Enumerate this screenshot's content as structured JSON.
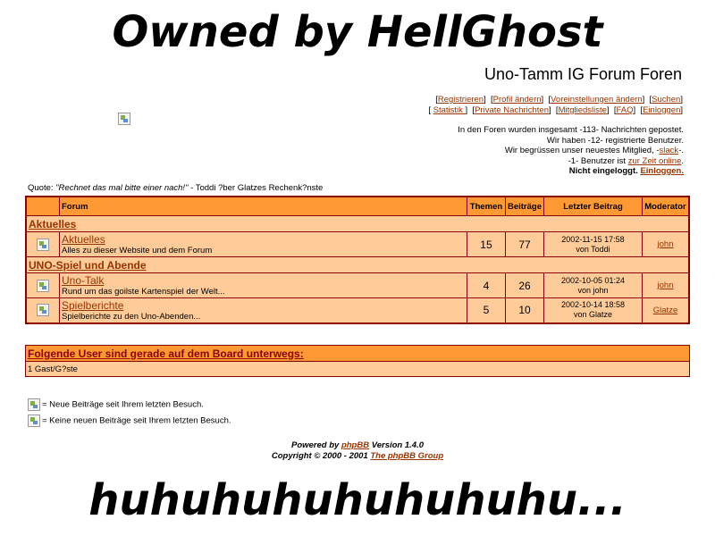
{
  "banner": {
    "top": "Owned by HellGhost",
    "bottom": "huhuhuhuhuhuhuhu..."
  },
  "site_title": "Uno-Tamm IG Forum Foren",
  "nav": {
    "row1": [
      "Registrieren",
      "Profil ändern",
      "Voreinstellungen ändern",
      "Suchen"
    ],
    "row2": [
      "Statistik ",
      "Private Nachrichten",
      "Mitgliedsliste",
      "FAQ",
      "Einloggen"
    ]
  },
  "stats": {
    "line1": "In den Foren wurden insgesamt -113- Nachrichten gepostet.",
    "line2": "Wir haben -12- registrierte Benutzer.",
    "line3_pre": "Wir begrüssen unser neuestes Mitglied, -",
    "line3_link": "slack",
    "line3_post": "-.",
    "line4_pre": "-1- Benutzer ist ",
    "line4_link": "zur Zeit online",
    "line4_post": ".",
    "line5_pre": "Nicht eingeloggt. ",
    "line5_link": "Einloggen."
  },
  "quote": {
    "label": "Quote: ",
    "text": "\"Rechnet das mal bitte einer nach!\"",
    "source": " - Toddi ?ber Glatzes Rechenk?nste"
  },
  "table": {
    "headers": {
      "forum": "Forum",
      "topics": "Themen",
      "posts": "Beiträge",
      "last": "Letzter Beitrag",
      "mod": "Moderator"
    },
    "categories": [
      {
        "name": "Aktuelles",
        "forums": [
          {
            "name": "Aktuelles",
            "desc": "Alles zu dieser Website und dem Forum",
            "topics": "15",
            "posts": "77",
            "last_date": "2002-11-15 17:58",
            "last_by": "von Toddi",
            "mod": "john"
          }
        ]
      },
      {
        "name": "UNO-Spiel und Abende",
        "forums": [
          {
            "name": "Uno-Talk",
            "desc": "Rund um das goilste Kartenspiel der Welt...",
            "topics": "4",
            "posts": "26",
            "last_date": "2002-10-05 01:24",
            "last_by": "von john",
            "mod": "john"
          },
          {
            "name": "Spielberichte",
            "desc": "Spielberichte zu den Uno-Abenden...",
            "topics": "5",
            "posts": "10",
            "last_date": "2002-10-14 18:58",
            "last_by": "von Glatze",
            "mod": "Glatze"
          }
        ]
      }
    ]
  },
  "online": {
    "title": "Folgende User sind gerade auf dem Board unterwegs:",
    "text": "1 Gast/G?ste"
  },
  "legend": {
    "new": "= Neue Beiträge seit Ihrem letzten Besuch.",
    "none": "= Keine neuen Beiträge seit Ihrem letzten Besuch."
  },
  "footer": {
    "line1_pre": "Powered by ",
    "line1_link": "phpBB",
    "line1_post": " Version 1.4.0",
    "line2_pre": "Copyright © 2000 - 2001 ",
    "line2_link": "The phpBB Group"
  },
  "colors": {
    "header_bg": "#ff9933",
    "row_bg": "#ffcc99",
    "border": "#8b0000",
    "link": "#993300"
  }
}
